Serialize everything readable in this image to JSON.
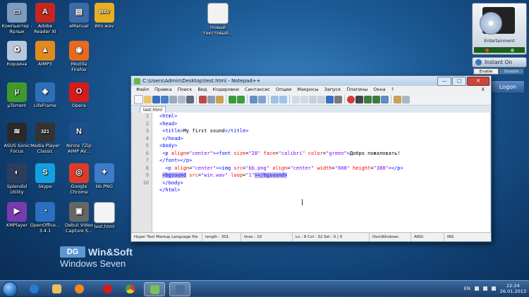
{
  "desktop": {
    "icons": [
      {
        "label": "Компьютер -\nЯрлык",
        "icon": "computer-icon",
        "color": "#7f9bbd",
        "glyph": "▭"
      },
      {
        "label": "Adobe\nReader XI",
        "icon": "pdf-icon",
        "color": "#c7261f",
        "glyph": "A"
      },
      {
        "label": "eManual",
        "icon": "book-icon",
        "color": "#3d6aa8",
        "glyph": "▤"
      },
      {
        "label": "Win.wav",
        "icon": "wav-file-icon",
        "color": "#e8b020",
        "glyph": "WAV"
      },
      {
        "label": "Новый\nтекстовый...",
        "icon": "text-file-icon",
        "color": "#f2f2f2",
        "glyph": ""
      },
      {
        "label": "Корзина",
        "icon": "recycle-bin-icon",
        "color": "#b8c8da",
        "glyph": "♻"
      },
      {
        "label": "AIMP3",
        "icon": "aimp-icon",
        "color": "#e08a1e",
        "glyph": "▲"
      },
      {
        "label": "Mozilla\nFirefox",
        "icon": "firefox-icon",
        "color": "#e86a1c",
        "glyph": "◉"
      },
      {
        "label": "µTorrent",
        "icon": "utorrent-icon",
        "color": "#3f9a2c",
        "glyph": "µ"
      },
      {
        "label": "LifeFrame",
        "icon": "lifeframe-icon",
        "color": "#2d6fb8",
        "glyph": "◈"
      },
      {
        "label": "Opera",
        "icon": "opera-icon",
        "color": "#d21c1c",
        "glyph": "O"
      },
      {
        "label": "ASUS Sonic\nFocus",
        "icon": "asus-icon",
        "color": "#2a2a2a",
        "glyph": "≋"
      },
      {
        "label": "Media Player\nClassic",
        "icon": "media-player-icon",
        "color": "#333",
        "glyph": "321"
      },
      {
        "label": "Ninite 7Zip\nAIMP AV...",
        "icon": "ninite-icon",
        "color": "#1e4f8c",
        "glyph": "N"
      },
      {
        "label": "Splendid\nUtility",
        "icon": "splendid-icon",
        "color": "#2c3e5c",
        "glyph": "◐"
      },
      {
        "label": "Skype",
        "icon": "skype-icon",
        "color": "#14a0e0",
        "glyph": "S"
      },
      {
        "label": "Google\nChrome",
        "icon": "chrome-icon",
        "color": "#dd3b2a",
        "glyph": "◎"
      },
      {
        "label": "bb.PNG",
        "icon": "png-file-icon",
        "color": "#3d7cc6",
        "glyph": "✦"
      },
      {
        "label": "KMPlayer",
        "icon": "kmplayer-icon",
        "color": "#7a3ab0",
        "glyph": "▶"
      },
      {
        "label": "OpenOffice...\n3.4.1",
        "icon": "openoffice-icon",
        "color": "#2a6fc0",
        "glyph": "◔"
      },
      {
        "label": "Debut Video\nCapture S...",
        "icon": "debut-icon",
        "color": "#666",
        "glyph": "▣"
      },
      {
        "label": "test.html",
        "icon": "html-file-icon",
        "color": "#f4f4f4",
        "glyph": ""
      }
    ]
  },
  "notepad": {
    "title": "C:\\Users\\Admin\\Desktop\\test.html - Notepad++",
    "min": "—",
    "max": "□",
    "close": "✕",
    "menu": [
      "Файл",
      "Правка",
      "Поиск",
      "Вид",
      "Кодировки",
      "Синтаксис",
      "Опции",
      "Макросы",
      "Запуск",
      "Плагины",
      "Окна",
      "?"
    ],
    "menu_close": "X",
    "tab": "test.html",
    "line_numbers": [
      "1",
      "2",
      "3",
      "4",
      "5",
      "6",
      "7",
      "8",
      "9",
      "10"
    ],
    "status": {
      "type": "Hyper Text Markup Language file",
      "length": "length : 301",
      "lines": "lines : 10",
      "pos": "Ln : 8   Col : 32   Sel : 0 | 0",
      "eol": "Dos\\Windows",
      "enc": "ANSI",
      "mode": "INS"
    }
  },
  "gadget": {
    "label": "Entertainment"
  },
  "instant_on": {
    "label": "Instant On",
    "enable": "Enable",
    "disable": "Disable"
  },
  "logon": "Logon",
  "brand": {
    "dg": "DG",
    "winsoft": "Win&Soft",
    "seven": "Windows Seven"
  },
  "tray": {
    "lang": "EN",
    "time": "22:24",
    "date": "26.01.2013"
  }
}
